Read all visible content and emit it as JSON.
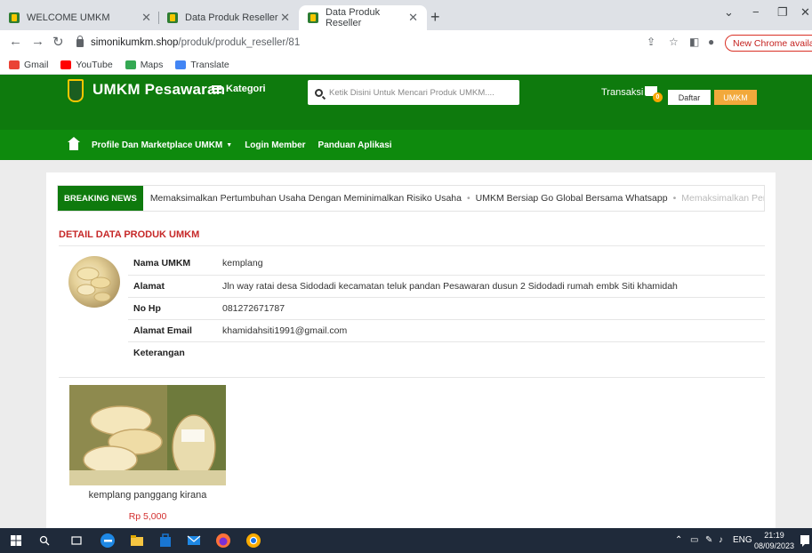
{
  "browser": {
    "tabs": [
      {
        "title": "WELCOME UMKM",
        "active": false
      },
      {
        "title": "Data Produk Reseller",
        "active": false
      },
      {
        "title": "Data Produk Reseller",
        "active": true
      }
    ],
    "url_domain": "simonikumkm.shop",
    "url_path": "/produk/produk_reseller/81",
    "update_label": "New Chrome available",
    "bookmarks": [
      "Gmail",
      "YouTube",
      "Maps",
      "Translate"
    ]
  },
  "header": {
    "site_title": "UMKM Pesawaran",
    "kategori_label": "Kategori",
    "search_placeholder": "Ketik Disini Untuk Mencari Produk UMKM....",
    "transaksi_label": "Transaksi",
    "cart_count": "0",
    "daftar_label": "Daftar",
    "umkm_label": "UMKM"
  },
  "nav": {
    "items": [
      "Profile Dan Marketplace UMKM",
      "Login Member",
      "Panduan Aplikasi"
    ]
  },
  "breaking_news": {
    "label": "BREAKING NEWS",
    "items": [
      "Memaksimalkan Pertumbuhan Usaha Dengan Meminimalkan Risiko Usaha",
      "UMKM Bersiap Go Global Bersama Whatsapp",
      "Memaksimalkan Pertumbuhan Usaha Dengan Mei"
    ]
  },
  "detail": {
    "section_title": "DETAIL DATA PRODUK UMKM",
    "rows": [
      {
        "key": "Nama UMKM",
        "value": "kemplang"
      },
      {
        "key": "Alamat",
        "value": "Jln way ratai desa Sidodadi kecamatan teluk pandan Pesawaran dusun 2 Sidodadi rumah embk Siti khamidah"
      },
      {
        "key": "No Hp",
        "value": "081272671787"
      },
      {
        "key": "Alamat Email",
        "value": "khamidahsiti1991@gmail.com"
      },
      {
        "key": "Keterangan",
        "value": ""
      }
    ]
  },
  "product": {
    "name": "kemplang panggang kirana",
    "price": "Rp 5,000"
  },
  "taskbar": {
    "lang": "ENG",
    "time": "21:19",
    "date": "08/09/2023"
  },
  "colors": {
    "header_green": "#0e7a0d",
    "nav_green": "#0e8a0d",
    "accent_orange": "#f2a93b",
    "title_red": "#c62828",
    "price_red": "#d32f2f"
  }
}
